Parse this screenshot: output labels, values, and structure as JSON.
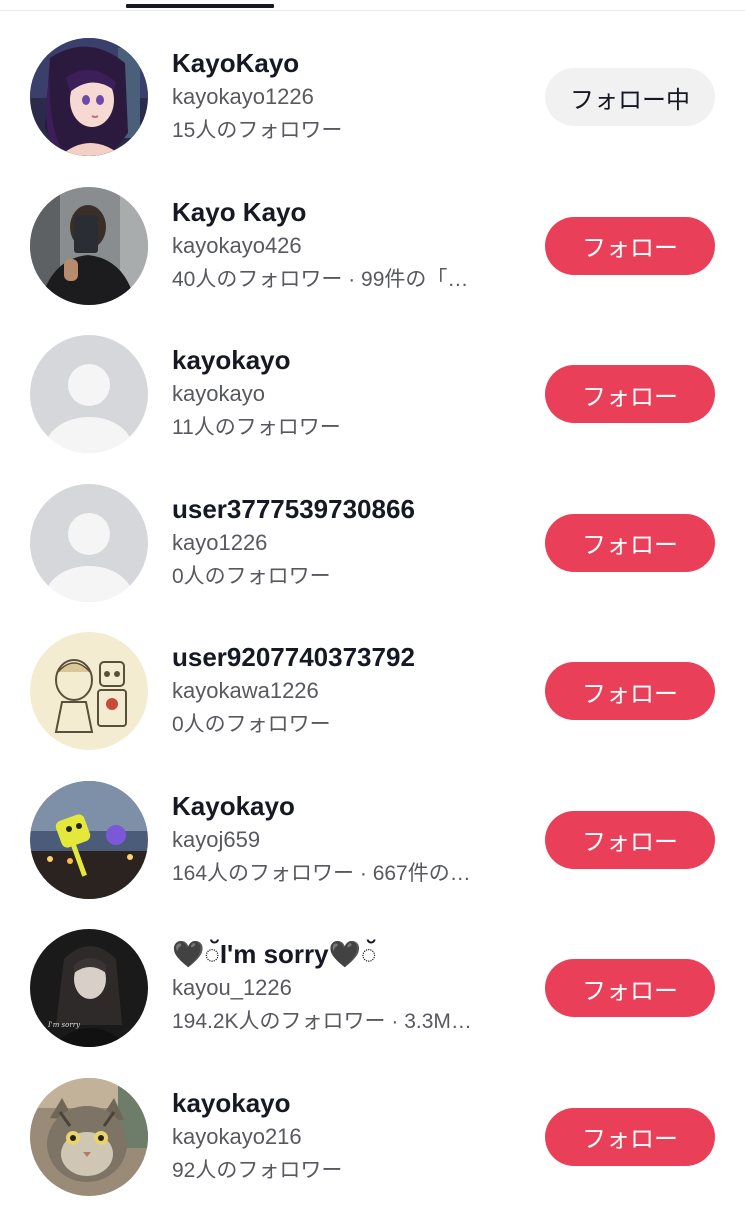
{
  "users": [
    {
      "name": "KayoKayo",
      "handle": "kayokayo1226",
      "meta": "15人のフォロワー",
      "button": "フォロー中",
      "following": true,
      "avatar": "anime-girl-avatar"
    },
    {
      "name": "Kayo Kayo",
      "handle": "kayokayo426",
      "meta": "40人のフォロワー · 99件の「…",
      "button": "フォロー",
      "following": false,
      "avatar": "mirror-selfie-avatar"
    },
    {
      "name": "kayokayo",
      "handle": "kayokayo",
      "meta": "11人のフォロワー",
      "button": "フォロー",
      "following": false,
      "avatar": "default-avatar"
    },
    {
      "name": "user3777539730866",
      "handle": "kayo1226",
      "meta": "0人のフォロワー",
      "button": "フォロー",
      "following": false,
      "avatar": "default-avatar"
    },
    {
      "name": "user9207740373792",
      "handle": "kayokawa1226",
      "meta": "0人のフォロワー",
      "button": "フォロー",
      "following": false,
      "avatar": "sketch-illustration-avatar"
    },
    {
      "name": "Kayokayo",
      "handle": "kayoj659",
      "meta": "164人のフォロワー · 667件の…",
      "button": "フォロー",
      "following": false,
      "avatar": "festival-night-avatar"
    },
    {
      "name": "🖤◌̆I'm sorry🖤◌̆",
      "handle": "kayou_1226",
      "meta": "194.2K人のフォロワー · 3.3M…",
      "button": "フォロー",
      "following": false,
      "avatar": "dark-portrait-avatar",
      "avatar_caption": "I'm sorry"
    },
    {
      "name": "kayokayo",
      "handle": "kayokayo216",
      "meta": "92人のフォロワー",
      "button": "フォロー",
      "following": false,
      "avatar": "cat-photo-avatar"
    }
  ],
  "colors": {
    "follow_button": "#ea3f59",
    "following_button": "#f1f1f2",
    "secondary_text": "#58595f",
    "primary_text": "#161823"
  }
}
